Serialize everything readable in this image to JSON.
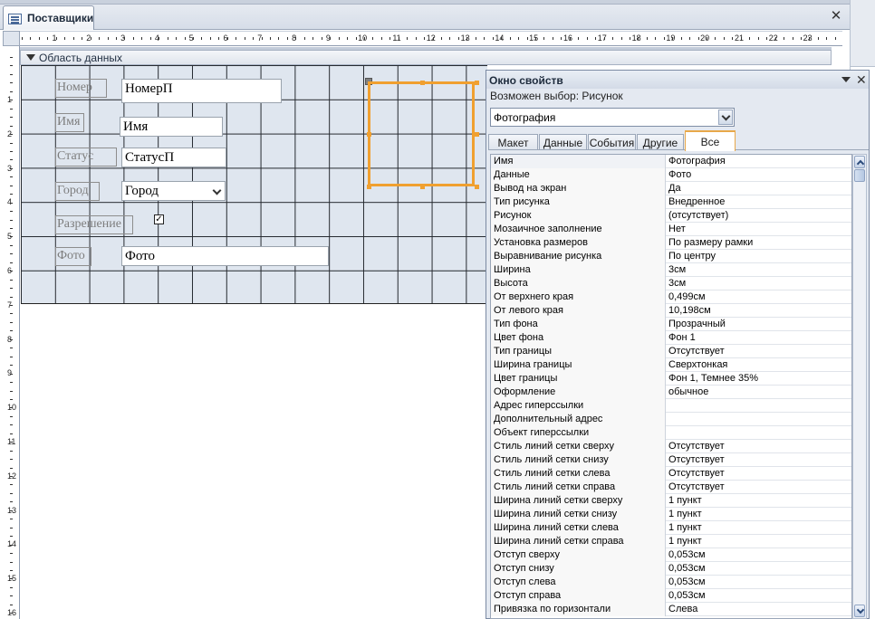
{
  "document_tab": {
    "title": "Поставщики"
  },
  "section": {
    "title": "Область данных"
  },
  "ruler": {
    "horizontal": [
      "1",
      "2",
      "3",
      "4",
      "5",
      "6",
      "7",
      "8",
      "9",
      "10",
      "11",
      "12",
      "13",
      "14",
      "15",
      "16",
      "17",
      "18",
      "19",
      "20",
      "21",
      "22",
      "23"
    ],
    "vertical": [
      "1",
      "2",
      "3",
      "4",
      "5",
      "6",
      "7",
      "8",
      "9",
      "10",
      "11",
      "12",
      "13",
      "14",
      "15",
      "16"
    ]
  },
  "form": {
    "labels": {
      "nomer": "Номер",
      "imya": "Имя",
      "status": "Статус",
      "gorod": "Город",
      "razreshenie": "Разрешение",
      "foto": "Фото"
    },
    "fields": {
      "nomer": "НомерП",
      "imya": "Имя",
      "status": "СтатусП",
      "gorod": "Город",
      "foto": "Фото"
    },
    "checkbox_checked": true
  },
  "property_sheet": {
    "title": "Окно свойств",
    "selection_type_label": "Возможен выбор:  Рисунок",
    "selected_object": "Фотография",
    "tabs": [
      "Макет",
      "Данные",
      "События",
      "Другие",
      "Все"
    ],
    "active_tab": "Все",
    "properties": [
      {
        "name": "Имя",
        "value": "Фотография"
      },
      {
        "name": "Данные",
        "value": "Фото"
      },
      {
        "name": "Вывод на экран",
        "value": "Да"
      },
      {
        "name": "Тип рисунка",
        "value": "Внедренное"
      },
      {
        "name": "Рисунок",
        "value": "(отсутствует)"
      },
      {
        "name": "Мозаичное заполнение",
        "value": "Нет"
      },
      {
        "name": "Установка размеров",
        "value": "По размеру рамки"
      },
      {
        "name": "Выравнивание рисунка",
        "value": "По центру"
      },
      {
        "name": "Ширина",
        "value": "3см"
      },
      {
        "name": "Высота",
        "value": "3см"
      },
      {
        "name": "От верхнего края",
        "value": "0,499см"
      },
      {
        "name": "От левого края",
        "value": "10,198см"
      },
      {
        "name": "Тип фона",
        "value": "Прозрачный"
      },
      {
        "name": "Цвет фона",
        "value": "Фон 1"
      },
      {
        "name": "Тип границы",
        "value": "Отсутствует"
      },
      {
        "name": "Ширина границы",
        "value": "Сверхтонкая"
      },
      {
        "name": "Цвет границы",
        "value": "Фон 1, Темнее 35%"
      },
      {
        "name": "Оформление",
        "value": "обычное"
      },
      {
        "name": "Адрес гиперссылки",
        "value": ""
      },
      {
        "name": "Дополнительный адрес",
        "value": ""
      },
      {
        "name": "Объект гиперссылки",
        "value": ""
      },
      {
        "name": "Стиль линий сетки сверху",
        "value": "Отсутствует"
      },
      {
        "name": "Стиль линий сетки снизу",
        "value": "Отсутствует"
      },
      {
        "name": "Стиль линий сетки слева",
        "value": "Отсутствует"
      },
      {
        "name": "Стиль линий сетки справа",
        "value": "Отсутствует"
      },
      {
        "name": "Ширина линий сетки сверху",
        "value": "1 пункт"
      },
      {
        "name": "Ширина линий сетки снизу",
        "value": "1 пункт"
      },
      {
        "name": "Ширина линий сетки слева",
        "value": "1 пункт"
      },
      {
        "name": "Ширина линий сетки справа",
        "value": "1 пункт"
      },
      {
        "name": "Отступ сверху",
        "value": "0,053см"
      },
      {
        "name": "Отступ снизу",
        "value": "0,053см"
      },
      {
        "name": "Отступ слева",
        "value": "0,053см"
      },
      {
        "name": "Отступ справа",
        "value": "0,053см"
      },
      {
        "name": "Привязка по горизонтали",
        "value": "Слева"
      }
    ]
  },
  "colors": {
    "selection": "#f0a030",
    "grid_bg": "#dfe6ef",
    "active_tab_border": "#e8a84a"
  },
  "icons": [
    "form-icon",
    "close-icon",
    "section-collapse-icon",
    "checkbox-icon",
    "dropdown-arrow-icon",
    "scroll-up-icon",
    "scroll-down-icon"
  ]
}
